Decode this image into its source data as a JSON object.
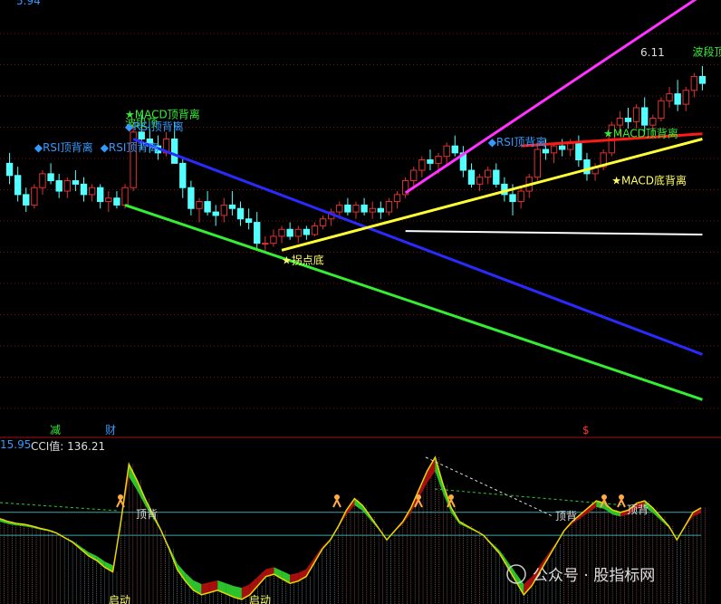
{
  "colors": {
    "up": "#e03232",
    "down": "#54ffff",
    "grid": "#7a1010",
    "magenta": "#ff33ff",
    "red_line": "#ff1a1a",
    "yellow": "#ffff33",
    "white": "#ffffff",
    "blue": "#2a2aff",
    "green": "#33ee33",
    "cci_yellow": "#e6d800",
    "cci_red": "#b01010",
    "cci_green": "#2ecc2e",
    "band_cyan": "#3aa6a6",
    "text_green": "#33ee33",
    "text_blue": "#3399ff",
    "text_yellow": "#ffff66",
    "text_white": "#dddddd",
    "text_red": "#ff3333"
  },
  "chart_data": [
    {
      "type": "candlestick",
      "title": "",
      "top_value": "5.94",
      "last_high_label": "6.11",
      "annotations": [
        {
          "text": "★MACD顶背离",
          "color": "text_green"
        },
        {
          "text": "波段顶",
          "color": "text_green"
        },
        {
          "text": "◆RSI顶背离",
          "color": "text_blue"
        },
        {
          "text": "◆RSI顶背离",
          "color": "text_blue"
        },
        {
          "text": "◆RSI顶背离",
          "color": "text_blue"
        },
        {
          "text": "◆RSI顶背离",
          "color": "text_blue"
        },
        {
          "text": "★拐点底",
          "color": "text_yellow"
        },
        {
          "text": "★MACD顶背离",
          "color": "text_green"
        },
        {
          "text": "★MACD底背离",
          "color": "text_yellow"
        },
        {
          "text": "波段顶",
          "color": "text_green"
        }
      ],
      "trend_lines": [
        {
          "name": "",
          "color": "blue"
        },
        {
          "name": "",
          "color": "green"
        },
        {
          "name": "",
          "color": "yellow"
        },
        {
          "name": "",
          "color": "magenta"
        },
        {
          "name": "",
          "color": "red_line"
        },
        {
          "name": "",
          "color": "white"
        }
      ],
      "candles": [
        [
          4.92,
          4.98,
          4.8,
          4.85
        ],
        [
          4.85,
          4.9,
          4.7,
          4.74
        ],
        [
          4.74,
          4.78,
          4.64,
          4.68
        ],
        [
          4.68,
          4.8,
          4.66,
          4.78
        ],
        [
          4.78,
          4.88,
          4.74,
          4.86
        ],
        [
          4.86,
          4.92,
          4.8,
          4.82
        ],
        [
          4.82,
          4.86,
          4.72,
          4.76
        ],
        [
          4.76,
          4.84,
          4.72,
          4.82
        ],
        [
          4.82,
          4.88,
          4.76,
          4.8
        ],
        [
          4.8,
          4.84,
          4.7,
          4.74
        ],
        [
          4.74,
          4.8,
          4.7,
          4.78
        ],
        [
          4.78,
          4.8,
          4.66,
          4.7
        ],
        [
          4.7,
          4.76,
          4.64,
          4.72
        ],
        [
          4.72,
          4.76,
          4.66,
          4.68
        ],
        [
          4.68,
          4.8,
          4.66,
          4.78
        ],
        [
          4.78,
          5.16,
          4.76,
          5.1
        ],
        [
          5.1,
          5.2,
          5.0,
          5.06
        ],
        [
          5.06,
          5.12,
          4.98,
          5.02
        ],
        [
          5.02,
          5.08,
          4.94,
          4.98
        ],
        [
          4.98,
          5.1,
          4.96,
          5.06
        ],
        [
          5.06,
          5.16,
          5.0,
          4.92
        ],
        [
          4.92,
          4.96,
          4.72,
          4.78
        ],
        [
          4.78,
          4.82,
          4.62,
          4.66
        ],
        [
          4.66,
          4.72,
          4.58,
          4.7
        ],
        [
          4.7,
          4.76,
          4.62,
          4.64
        ],
        [
          4.64,
          4.68,
          4.56,
          4.62
        ],
        [
          4.62,
          4.72,
          4.58,
          4.68
        ],
        [
          4.68,
          4.76,
          4.62,
          4.66
        ],
        [
          4.66,
          4.7,
          4.56,
          4.6
        ],
        [
          4.6,
          4.66,
          4.54,
          4.58
        ],
        [
          4.58,
          4.64,
          4.42,
          4.46
        ],
        [
          4.46,
          4.5,
          4.4,
          4.46
        ],
        [
          4.46,
          4.54,
          4.44,
          4.5
        ],
        [
          4.5,
          4.56,
          4.46,
          4.54
        ],
        [
          4.54,
          4.58,
          4.48,
          4.5
        ],
        [
          4.5,
          4.56,
          4.46,
          4.54
        ],
        [
          4.54,
          4.56,
          4.48,
          4.51
        ],
        [
          4.51,
          4.58,
          4.5,
          4.56
        ],
        [
          4.56,
          4.62,
          4.54,
          4.6
        ],
        [
          4.6,
          4.66,
          4.56,
          4.64
        ],
        [
          4.64,
          4.7,
          4.6,
          4.68
        ],
        [
          4.68,
          4.72,
          4.62,
          4.64
        ],
        [
          4.64,
          4.7,
          4.6,
          4.68
        ],
        [
          4.68,
          4.72,
          4.62,
          4.64
        ],
        [
          4.64,
          4.7,
          4.6,
          4.66
        ],
        [
          4.66,
          4.7,
          4.6,
          4.64
        ],
        [
          4.64,
          4.72,
          4.62,
          4.7
        ],
        [
          4.7,
          4.76,
          4.66,
          4.74
        ],
        [
          4.74,
          4.84,
          4.72,
          4.82
        ],
        [
          4.82,
          4.9,
          4.78,
          4.88
        ],
        [
          4.88,
          4.96,
          4.84,
          4.94
        ],
        [
          4.94,
          5.0,
          4.88,
          4.92
        ],
        [
          4.92,
          4.98,
          4.86,
          4.96
        ],
        [
          4.96,
          5.04,
          4.9,
          5.02
        ],
        [
          5.02,
          5.08,
          4.96,
          4.98
        ],
        [
          4.98,
          5.02,
          4.84,
          4.88
        ],
        [
          4.88,
          4.92,
          4.78,
          4.8
        ],
        [
          4.8,
          4.86,
          4.76,
          4.84
        ],
        [
          4.84,
          4.9,
          4.8,
          4.88
        ],
        [
          4.88,
          4.92,
          4.78,
          4.8
        ],
        [
          4.8,
          4.84,
          4.7,
          4.74
        ],
        [
          4.74,
          4.8,
          4.62,
          4.7
        ],
        [
          4.7,
          4.78,
          4.66,
          4.76
        ],
        [
          4.76,
          4.86,
          4.72,
          4.84
        ],
        [
          4.84,
          5.02,
          4.82,
          5.0
        ],
        [
          5.0,
          5.06,
          4.94,
          4.98
        ],
        [
          4.98,
          5.04,
          4.92,
          5.02
        ],
        [
          5.02,
          5.06,
          4.96,
          5.0
        ],
        [
          5.0,
          5.06,
          4.96,
          5.04
        ],
        [
          5.04,
          5.08,
          4.9,
          4.94
        ],
        [
          4.94,
          4.98,
          4.82,
          4.86
        ],
        [
          4.86,
          4.92,
          4.82,
          4.9
        ],
        [
          4.9,
          5.0,
          4.88,
          4.98
        ],
        [
          4.98,
          5.16,
          4.96,
          5.14
        ],
        [
          5.14,
          5.22,
          5.08,
          5.18
        ],
        [
          5.18,
          5.24,
          5.12,
          5.16
        ],
        [
          5.16,
          5.26,
          5.12,
          5.24
        ],
        [
          5.24,
          5.3,
          5.1,
          5.14
        ],
        [
          5.14,
          5.2,
          5.06,
          5.18
        ],
        [
          5.18,
          5.3,
          5.16,
          5.28
        ],
        [
          5.28,
          5.36,
          5.24,
          5.32
        ],
        [
          5.32,
          5.4,
          5.22,
          5.26
        ],
        [
          5.26,
          5.36,
          5.22,
          5.34
        ],
        [
          5.34,
          5.44,
          5.3,
          5.42
        ],
        [
          5.42,
          5.48,
          5.34,
          5.38
        ]
      ]
    },
    {
      "type": "area",
      "title": "",
      "header_left": "15.95",
      "header_label": "CCI值: 136.21",
      "markers": [
        {
          "text": "减",
          "color": "text_green"
        },
        {
          "text": "财",
          "color": "text_blue"
        },
        {
          "text": "$",
          "color": "text_red"
        }
      ],
      "annotations": [
        {
          "text": "顶背",
          "color": "text_white"
        },
        {
          "text": "顶背",
          "color": "text_white"
        },
        {
          "text": "顶背",
          "color": "text_white"
        },
        {
          "text": "启动",
          "color": "text_yellow"
        },
        {
          "text": "启动",
          "color": "text_yellow"
        }
      ],
      "watermark": "公众号 · 股指标网",
      "values": [
        72,
        60,
        52,
        48,
        40,
        30,
        22,
        10,
        -10,
        -30,
        -60,
        -90,
        -110,
        -140,
        -160,
        60,
        310,
        240,
        160,
        90,
        20,
        -60,
        -150,
        -200,
        -240,
        -260,
        -250,
        -240,
        -255,
        -270,
        -280,
        -260,
        -220,
        -180,
        -170,
        -190,
        -210,
        -200,
        -180,
        -120,
        -60,
        -20,
        40,
        110,
        160,
        130,
        80,
        30,
        -20,
        20,
        60,
        120,
        200,
        280,
        340,
        220,
        120,
        60,
        40,
        20,
        0,
        -40,
        -80,
        -140,
        -200,
        -260,
        -220,
        -160,
        -100,
        -40,
        20,
        60,
        90,
        120,
        150,
        140,
        110,
        100,
        110,
        140,
        150,
        120,
        80,
        40,
        -20,
        40,
        100,
        120
      ]
    }
  ]
}
